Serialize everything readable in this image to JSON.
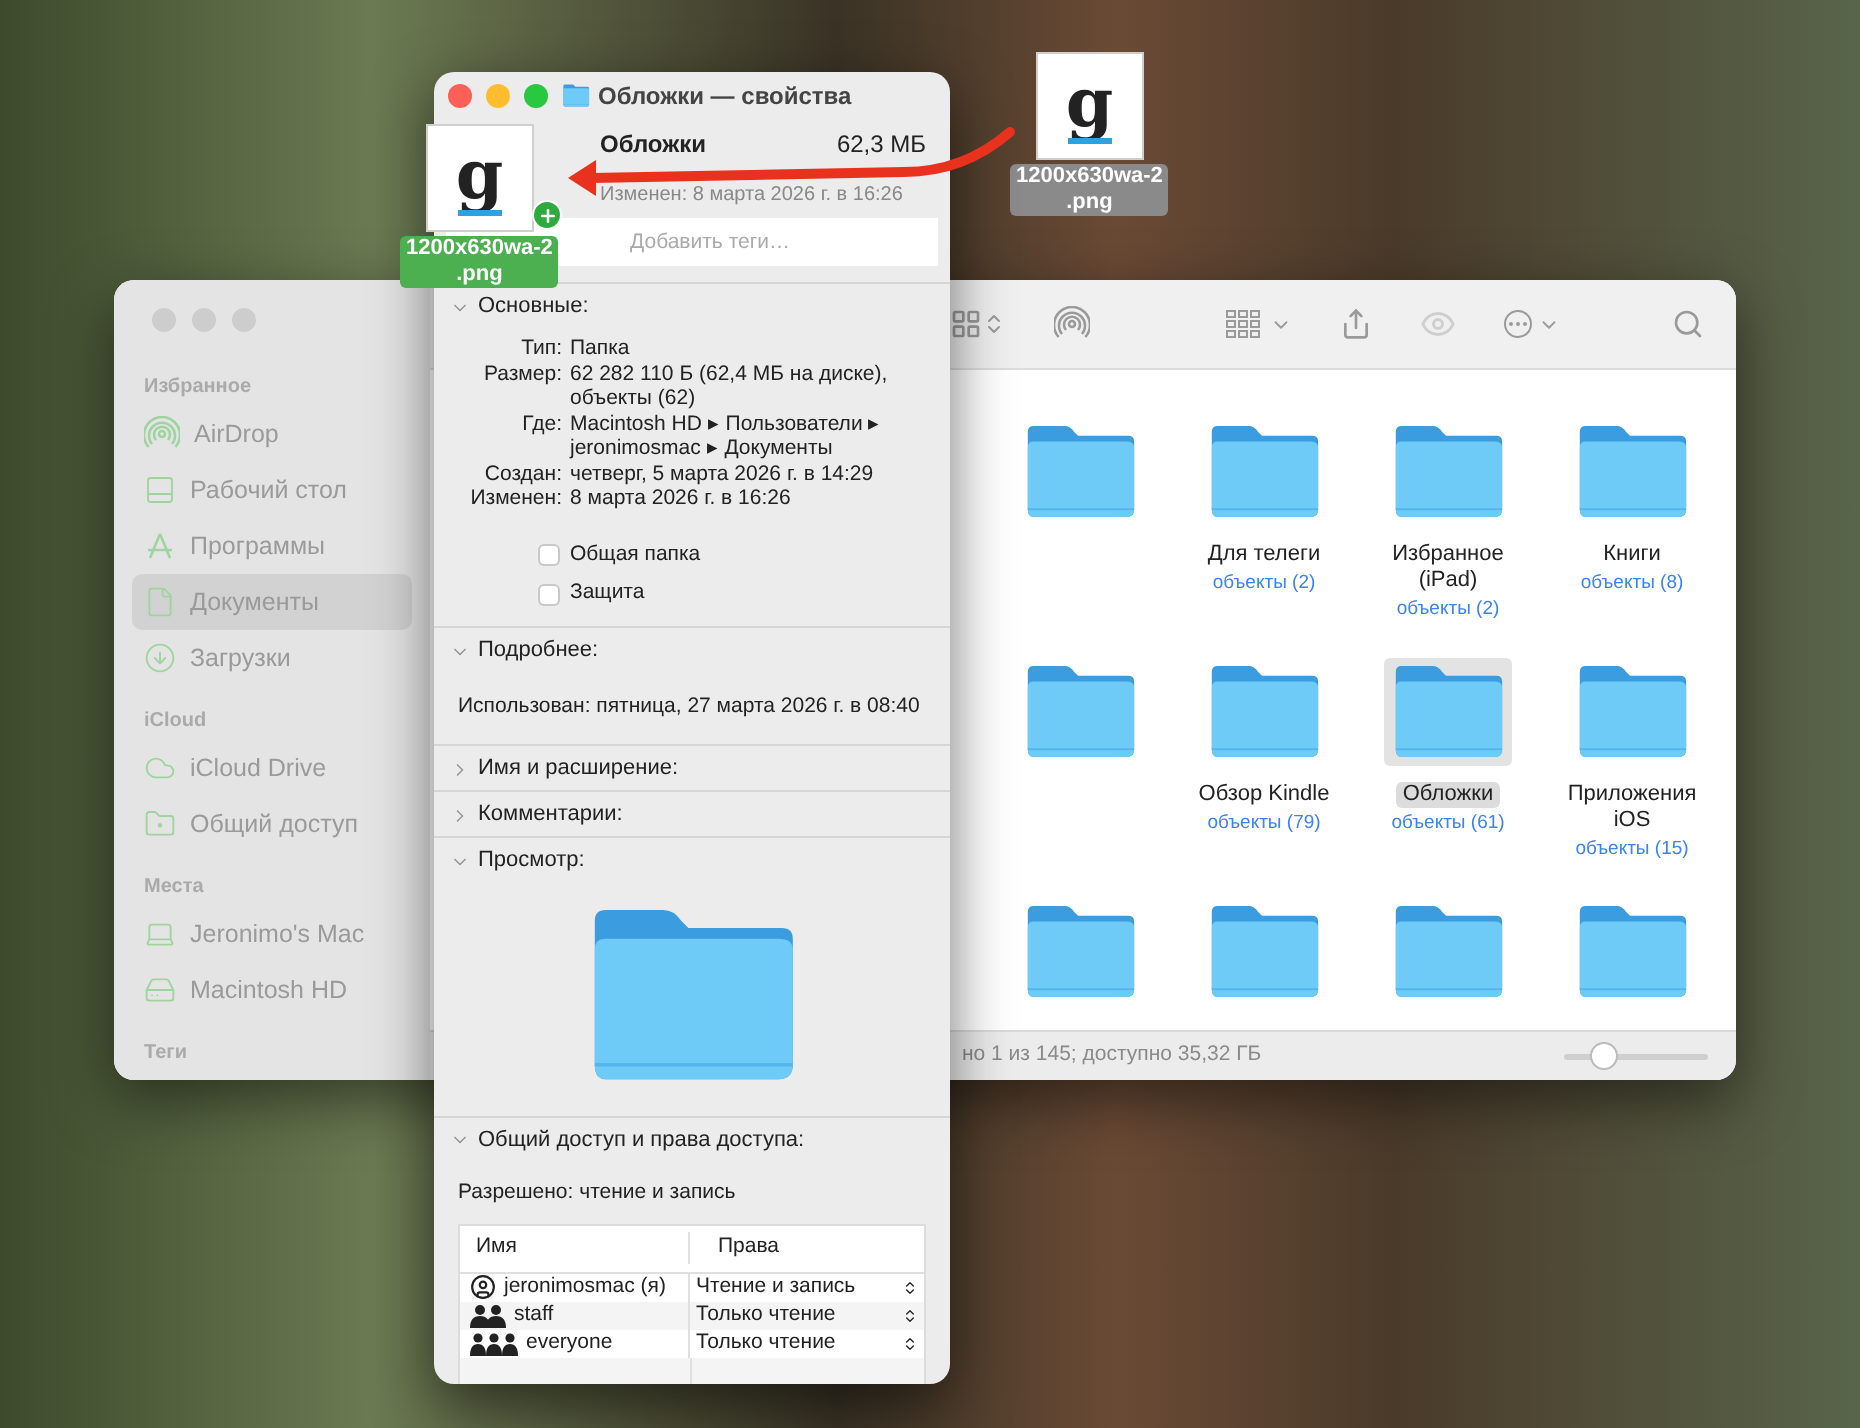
{
  "desktop": {
    "dragged_file": {
      "logo_text": "g",
      "label_lines": [
        "1200x630wa-2",
        ".png"
      ]
    }
  },
  "finder": {
    "sidebar": [
      {
        "title": "Избранное",
        "items": [
          {
            "kind": "airdrop",
            "label": "AirDrop",
            "selected": false
          },
          {
            "kind": "desktop",
            "label": "Рабочий стол",
            "selected": false
          },
          {
            "kind": "apps",
            "label": "Программы",
            "selected": false
          },
          {
            "kind": "documents",
            "label": "Документы",
            "selected": true
          },
          {
            "kind": "downloads",
            "label": "Загрузки",
            "selected": false
          }
        ]
      },
      {
        "title": "iCloud",
        "items": [
          {
            "kind": "icloud",
            "label": "iCloud Drive",
            "selected": false
          },
          {
            "kind": "shared",
            "label": "Общий доступ",
            "selected": false
          }
        ]
      },
      {
        "title": "Места",
        "items": [
          {
            "kind": "computer",
            "label": "Jeronimo's Mac",
            "selected": false
          },
          {
            "kind": "disk",
            "label": "Macintosh HD",
            "selected": false
          }
        ]
      },
      {
        "title": "Теги"
      }
    ],
    "items": [
      {
        "selected": false
      },
      {
        "name_lines": [
          "Для телеги"
        ],
        "count": "объекты (2)",
        "selected": false
      },
      {
        "name_lines": [
          "Избранное",
          "(iPad)"
        ],
        "count": "объекты (2)",
        "selected": false
      },
      {
        "name_lines": [
          "Книги"
        ],
        "count": "объекты (8)",
        "selected": false
      },
      {
        "selected": false
      },
      {
        "name_lines": [
          "Обзор Kindle"
        ],
        "count": "объекты (79)",
        "selected": false
      },
      {
        "name_lines": [
          "Обложки"
        ],
        "count": "объекты (61)",
        "selected": true
      },
      {
        "name_lines": [
          "Приложения",
          "iOS"
        ],
        "count": "объекты (15)",
        "selected": false
      },
      {
        "selected": false
      },
      {
        "selected": false
      },
      {
        "selected": false
      },
      {
        "selected": false
      }
    ],
    "status_bar": {
      "text": "но 1 из 145; доступно 35,32 ГБ",
      "icon_size": {
        "level": 0.28
      }
    }
  },
  "info_window": {
    "title": "Обложки — свойства",
    "name": "Обложки",
    "size": "62,3 МБ",
    "modified": "Изменен: 8 марта 2026 г. в 16:26",
    "tags_placeholder": "Добавить теги…",
    "drag_file": {
      "logo_text": "g",
      "label_lines": [
        "1200x630wa-2",
        ".png"
      ]
    },
    "sections": [
      {
        "kind": "general",
        "title": "Основные:",
        "expanded": true,
        "rows": [
          {
            "key": "Тип:",
            "value_lines": [
              "Папка"
            ]
          },
          {
            "key": "Размер:",
            "value_lines": [
              "62 282 110 Б (62,4 МБ на диске),",
              "объекты (62)"
            ]
          },
          {
            "key": "Где:",
            "value_lines": [
              "Macintosh HD ▸ Пользователи ▸",
              "jeronimosmac ▸ Документы"
            ]
          },
          {
            "key": "Создан:",
            "value_lines": [
              "четверг, 5 марта 2026 г. в 14:29"
            ]
          },
          {
            "key": "Изменен:",
            "value_lines": [
              "8 марта 2026 г. в 16:26"
            ]
          }
        ],
        "checkboxes": [
          {
            "label": "Общая папка",
            "checked": false
          },
          {
            "label": "Защита",
            "checked": false
          }
        ]
      },
      {
        "kind": "more",
        "title": "Подробнее:",
        "expanded": true,
        "line": "Использован: пятница, 27 марта 2026 г. в 08:40"
      },
      {
        "kind": "plain",
        "title": "Имя и расширение:",
        "expanded": false
      },
      {
        "kind": "plain",
        "title": "Комментарии:",
        "expanded": false
      },
      {
        "kind": "preview",
        "title": "Просмотр:",
        "expanded": true
      },
      {
        "kind": "sharing",
        "title": "Общий доступ и права доступа:",
        "expanded": true,
        "summary": "Разрешено: чтение и запись",
        "columns": [
          "Имя",
          "Права"
        ],
        "rows": [
          {
            "kind": "user",
            "name": "jeronimosmac (я)",
            "privilege": "Чтение и запись"
          },
          {
            "kind": "group",
            "name": "staff",
            "privilege": "Только чтение"
          },
          {
            "kind": "everyone",
            "name": "everyone",
            "privilege": "Только чтение"
          }
        ]
      }
    ]
  }
}
